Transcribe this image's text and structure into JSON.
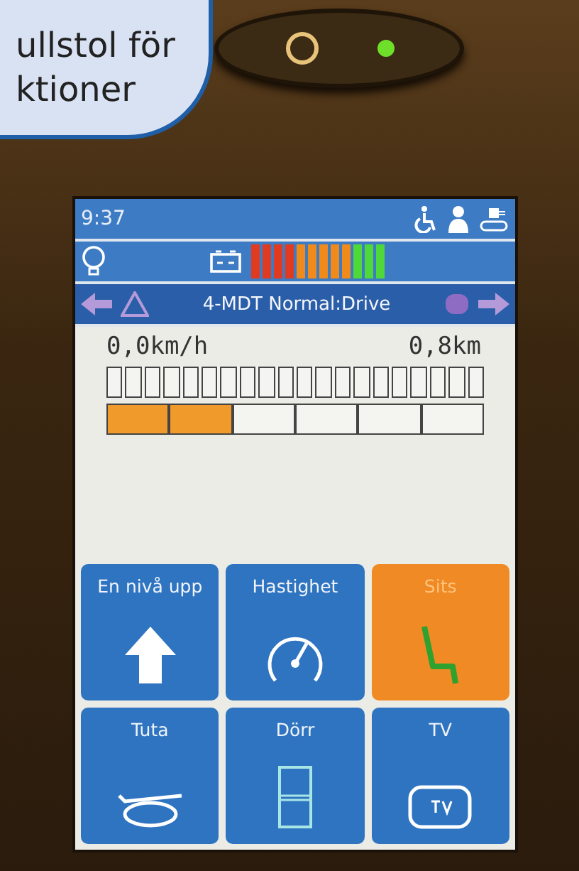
{
  "callout": {
    "lines": [
      "ullstol för",
      "ktioner"
    ]
  },
  "status_bar": {
    "time": "9:37"
  },
  "mode_bar": {
    "title": "4-MDT Normal:Drive"
  },
  "readouts": {
    "speed": "0,0km/h",
    "distance": "0,8km"
  },
  "power_bar": {
    "level": 0.33
  },
  "tiles": [
    {
      "label": "En nivå upp",
      "kind": "up",
      "selected": false
    },
    {
      "label": "Hastighet",
      "kind": "speed",
      "selected": false
    },
    {
      "label": "Sits",
      "kind": "seat",
      "selected": true
    },
    {
      "label": "Tuta",
      "kind": "horn",
      "selected": false
    },
    {
      "label": "Dörr",
      "kind": "door",
      "selected": false
    },
    {
      "label": "TV",
      "kind": "tv",
      "selected": false
    }
  ]
}
